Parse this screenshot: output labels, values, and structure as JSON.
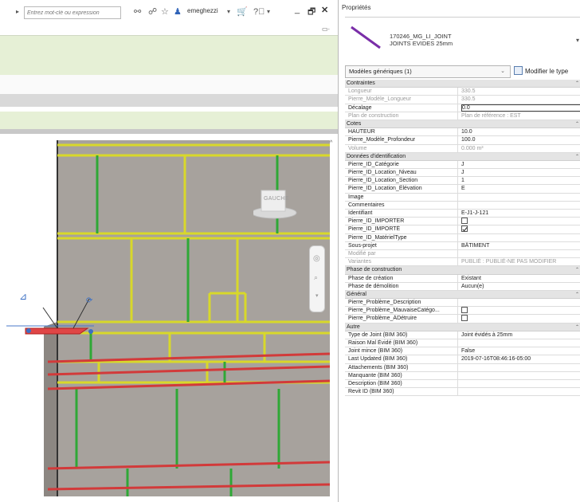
{
  "toolbar": {
    "search_placeholder": "Entrez mot-clé ou expression",
    "user_name": "emeghezzi"
  },
  "icons": {
    "binoculars": "binoculars-icon",
    "subscription": "subscription-icon",
    "favorite": "star-icon",
    "user": "user-icon",
    "cart": "cart-icon",
    "help": "help-icon"
  },
  "viewcube": {
    "label": "GAUCHE"
  },
  "properties": {
    "title": "Propriétés",
    "type_name_line1": "170246_MG_LI_JOINT",
    "type_name_line2": "JOINTS EVIDES 25mm",
    "selector": "Modèles génériques (1)",
    "edit_type": "Modifier le type",
    "groups": [
      {
        "name": "Contraintes",
        "rows": [
          {
            "label": "Longueur",
            "value": "330.5",
            "disabled": true
          },
          {
            "label": "Pierre_Modèle_Longueur",
            "value": "330.5",
            "disabled": true
          },
          {
            "label": "Décalage",
            "value": "0.0",
            "selected": true
          },
          {
            "label": "Plan de construction",
            "value": "Plan de référence : EST",
            "disabled": true
          }
        ]
      },
      {
        "name": "Cotes",
        "rows": [
          {
            "label": "HAUTEUR",
            "value": "10.0"
          },
          {
            "label": "Pierre_Modèle_Profondeur",
            "value": "100.0"
          },
          {
            "label": "Volume",
            "value": "0.000 m³",
            "disabled": true
          }
        ]
      },
      {
        "name": "Données d'identification",
        "rows": [
          {
            "label": "Pierre_ID_Catégorie",
            "value": "J"
          },
          {
            "label": "Pierre_ID_Location_Niveau",
            "value": "J"
          },
          {
            "label": "Pierre_ID_Location_Section",
            "value": "1"
          },
          {
            "label": "Pierre_ID_Location_Élévation",
            "value": "E"
          },
          {
            "label": "Image",
            "value": ""
          },
          {
            "label": "Commentaires",
            "value": ""
          },
          {
            "label": "Identifiant",
            "value": "E-J1-J-121"
          },
          {
            "label": "Pierre_ID_IMPORTER",
            "value": "",
            "checkbox": false
          },
          {
            "label": "Pierre_ID_IMPORTÉ",
            "value": "",
            "checkbox": true
          },
          {
            "label": "Pierre_ID_MatérielType",
            "value": ""
          },
          {
            "label": "Sous-projet",
            "value": "BÂTIMENT"
          },
          {
            "label": "Modifié par",
            "value": "",
            "disabled": true
          },
          {
            "label": "Variantes",
            "value": "PUBLIÉ : PUBLIÉ-NE PAS MODIFIER",
            "disabled": true
          }
        ]
      },
      {
        "name": "Phase de construction",
        "rows": [
          {
            "label": "Phase de création",
            "value": "Existant"
          },
          {
            "label": "Phase de démolition",
            "value": "Aucun(e)"
          }
        ]
      },
      {
        "name": "Général",
        "rows": [
          {
            "label": "Pierre_Problème_Description",
            "value": ""
          },
          {
            "label": "Pierre_Problème_MauvaiseCatégo...",
            "value": "",
            "checkbox": false
          },
          {
            "label": "Pierre_Problème_ÀDétruire",
            "value": "",
            "checkbox": false
          }
        ]
      },
      {
        "name": "Autre",
        "rows": [
          {
            "label": "Type de Joint (BIM 360)",
            "value": "Joint évidés à 25mm"
          },
          {
            "label": "Raison Mal Évidé (BIM 360)",
            "value": ""
          },
          {
            "label": "Joint mince (BIM 360)",
            "value": "False"
          },
          {
            "label": "Last Updated (BIM 360)",
            "value": "2019-07-16T08:46:16-05:00"
          },
          {
            "label": "Attachements (BIM 360)",
            "value": ""
          },
          {
            "label": "Manquante (BIM 360)",
            "value": ""
          },
          {
            "label": "Description (BIM 360)",
            "value": ""
          },
          {
            "label": "Revit ID (BIM 360)",
            "value": ""
          }
        ]
      }
    ]
  },
  "colors": {
    "wall": "#a7a29d",
    "joint_yellow": "#d8d82a",
    "joint_green": "#2fa836",
    "joint_red": "#d23a3a",
    "selected_type": "#7a2ea8",
    "ribbon_green": "#e6f0d6"
  }
}
